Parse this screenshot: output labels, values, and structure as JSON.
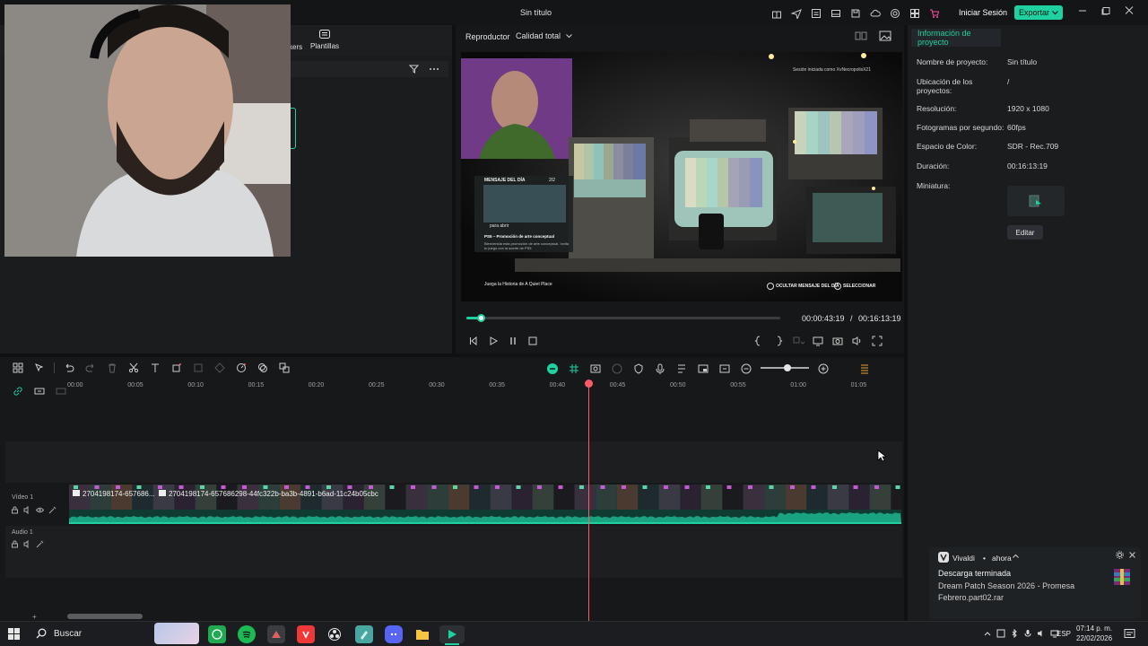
{
  "titlebar": {
    "title": "Sin título",
    "login_label": "Iniciar Sesión",
    "export_label": "Exportar",
    "accent_color": "#1fd0a0"
  },
  "left_panel": {
    "tab_plantillas": "Plantillas",
    "tab_stickers_partial": "kers"
  },
  "player": {
    "label": "Reproductor",
    "quality": "Calidad total",
    "timecode_current": "00:00:43:19",
    "timecode_separator": "/",
    "timecode_total": "00:16:13:19",
    "progress_fraction": 0.045,
    "preview": {
      "session_text": "Sesión iniciada como XvNecropolisX21",
      "motd_title": "MENSAJE DEL DÍA",
      "motd_page": "2/2",
      "press_open": "para abrir",
      "promo_title": "PS5 – Promoción de arte conceptual",
      "promo_body": "Bienvenida esta promoción de arte conceptual. Invita tu juego con la suerte de PS5",
      "play_story": "Juega la Historia de A Quiet Place",
      "hide_motd": "OCULTAR MENSAJE DEL DÍA",
      "select": "SELECCIONAR"
    }
  },
  "properties": {
    "tab_label": "Información de proyecto",
    "rows": [
      {
        "label": "Nombre de proyecto:",
        "value": "Sin título"
      },
      {
        "label": "Ubicación de los proyectos:",
        "value": "/"
      },
      {
        "label": "Resolución:",
        "value": "1920 x 1080"
      },
      {
        "label": "Fotogramas por segundo:",
        "value": "60fps"
      },
      {
        "label": "Espacio de Color:",
        "value": "SDR - Rec.709"
      },
      {
        "label": "Duración:",
        "value": "00:16:13:19"
      },
      {
        "label": "Miniatura:",
        "value": ""
      }
    ],
    "edit_label": "Editar"
  },
  "timeline": {
    "ruler": [
      "00:00",
      "00:05",
      "00:10",
      "00:15",
      "00:20",
      "00:25",
      "00:30",
      "00:35",
      "00:40",
      "00:45",
      "00:50",
      "00:55",
      "01:00",
      "01:05"
    ],
    "video_track_label": "Vídeo 1",
    "audio_track_label": "Audio 1",
    "clip1_name": "2704198174-657686...",
    "clip2_name": "2704198174-657686298-44fc322b-ba3b-4891-b6ad-11c24b05cbc",
    "playhead_color": "#ff5a6a"
  },
  "notification": {
    "app": "Vivaldi",
    "time": "ahora",
    "title": "Descarga terminada",
    "body_line1": "Dream Patch Season 2026 - Promesa",
    "body_line2": "Febrero.part02.rar"
  },
  "taskbar": {
    "search_label": "Buscar",
    "lang": "ESP",
    "time": "07:14 p. m.",
    "date": "22/02/2026"
  }
}
